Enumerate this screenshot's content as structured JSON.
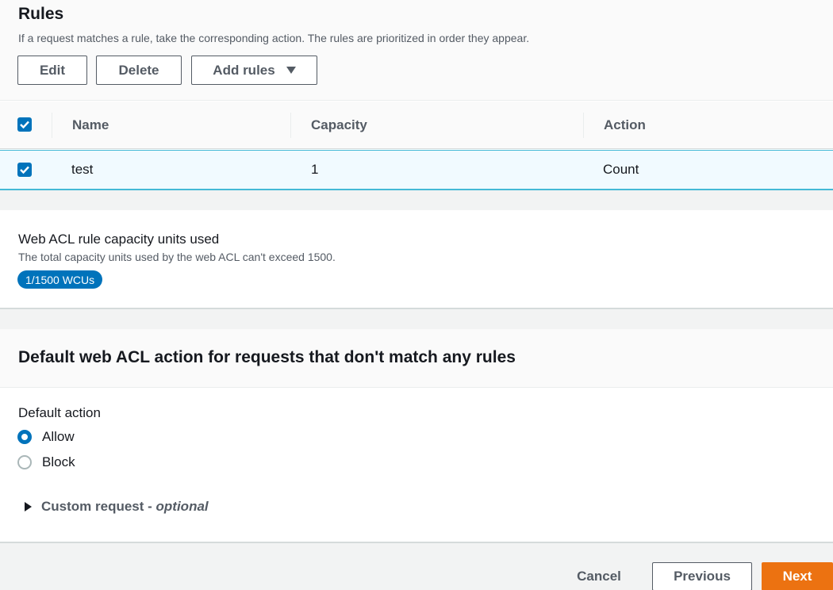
{
  "rules": {
    "title": "Rules",
    "description": "If a request matches a rule, take the corresponding action. The rules are prioritized in order they appear.",
    "edit_label": "Edit",
    "delete_label": "Delete",
    "add_rules_label": "Add rules",
    "columns": [
      "Name",
      "Capacity",
      "Action"
    ],
    "rows": [
      {
        "name": "test",
        "capacity": "1",
        "action": "Count",
        "selected": true
      }
    ]
  },
  "capacity": {
    "title": "Web ACL rule capacity units used",
    "description": "The total capacity units used by the web ACL can't exceed 1500.",
    "badge": "1/1500 WCUs"
  },
  "default_action": {
    "title": "Default web ACL action for requests that don't match any rules",
    "label": "Default action",
    "options": [
      {
        "label": "Allow",
        "selected": true
      },
      {
        "label": "Block",
        "selected": false
      }
    ],
    "custom_request_label": "Custom request - ",
    "custom_request_optional": "optional"
  },
  "footer": {
    "cancel_label": "Cancel",
    "previous_label": "Previous",
    "next_label": "Next"
  },
  "colors": {
    "primary_blue": "#0073bb",
    "orange": "#ec7211",
    "selected_row_bg": "#f1faff",
    "selected_row_border": "#44b9d6"
  },
  "icons": {
    "dropdown": "caret-down-icon",
    "expand": "caret-right-icon",
    "checkbox": "check-icon"
  }
}
